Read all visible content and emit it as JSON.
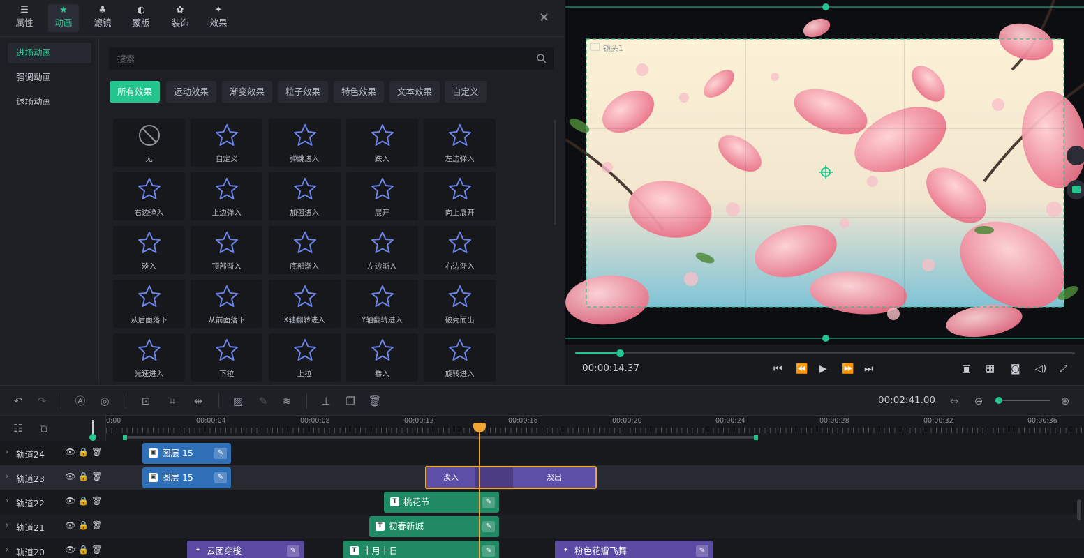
{
  "top_tabs": [
    {
      "label": "属性",
      "icon": "sliders-icon",
      "glyph": "☰"
    },
    {
      "label": "动画",
      "icon": "star-icon",
      "glyph": "★"
    },
    {
      "label": "滤镜",
      "icon": "filter-icon",
      "glyph": "♣"
    },
    {
      "label": "蒙版",
      "icon": "mask-icon",
      "glyph": "◐"
    },
    {
      "label": "装饰",
      "icon": "decor-icon",
      "glyph": "✿"
    },
    {
      "label": "效果",
      "icon": "sparkle-icon",
      "glyph": "✦"
    }
  ],
  "active_top_tab": "动画",
  "close_glyph": "✕",
  "side_nav": [
    "进场动画",
    "强调动画",
    "退场动画"
  ],
  "search": {
    "placeholder": "搜索"
  },
  "filter_chips": [
    "所有效果",
    "运动效果",
    "渐变效果",
    "粒子效果",
    "特色效果",
    "文本效果",
    "自定义"
  ],
  "effects": [
    "无",
    "自定义",
    "弹跳进入",
    "跌入",
    "左边弹入",
    "右边弹入",
    "上边弹入",
    "加强进入",
    "展开",
    "向上展开",
    "淡入",
    "顶部渐入",
    "底部渐入",
    "左边渐入",
    "右边渐入",
    "从后面落下",
    "从前面落下",
    "X轴翻转进入",
    "Y轴翻转进入",
    "破壳而出",
    "光速进入",
    "下拉",
    "上拉",
    "卷入",
    "旋转进入"
  ],
  "preview": {
    "camera_label": "镜头1",
    "current_time": "00:00:14.37",
    "progress": 0.09
  },
  "toolbar": {
    "total_time": "00:02:41.00"
  },
  "ruler_ticks": [
    "0:00",
    "00:00:04",
    "00:00:08",
    "00:00:12",
    "00:00:16",
    "00:00:20",
    "00:00:24",
    "00:00:28",
    "00:00:32",
    "00:00:36"
  ],
  "tracks": [
    {
      "name": "轨道24",
      "clips": [
        {
          "label": "图层 15",
          "type": "img"
        }
      ]
    },
    {
      "name": "轨道23",
      "clips": [
        {
          "label": "图层 15",
          "type": "img"
        },
        {
          "label": "淡入",
          "type": "fx"
        },
        {
          "label": "淡出",
          "type": "fx"
        }
      ]
    },
    {
      "name": "轨道22",
      "clips": [
        {
          "label": "桃花节",
          "type": "txt"
        }
      ]
    },
    {
      "name": "轨道21",
      "clips": [
        {
          "label": "初春新城",
          "type": "txt"
        }
      ]
    },
    {
      "name": "轨道20",
      "clips": [
        {
          "label": "云团穿梭",
          "type": "fx"
        },
        {
          "label": "十月十日",
          "type": "txt"
        },
        {
          "label": "粉色花瓣飞舞",
          "type": "fx"
        }
      ]
    }
  ],
  "colors": {
    "accent": "#23c48e",
    "playhead": "#f0a537",
    "clip_image": "#2f6fb8",
    "clip_text": "#1f8a63",
    "clip_effect": "#5a4aa2"
  }
}
